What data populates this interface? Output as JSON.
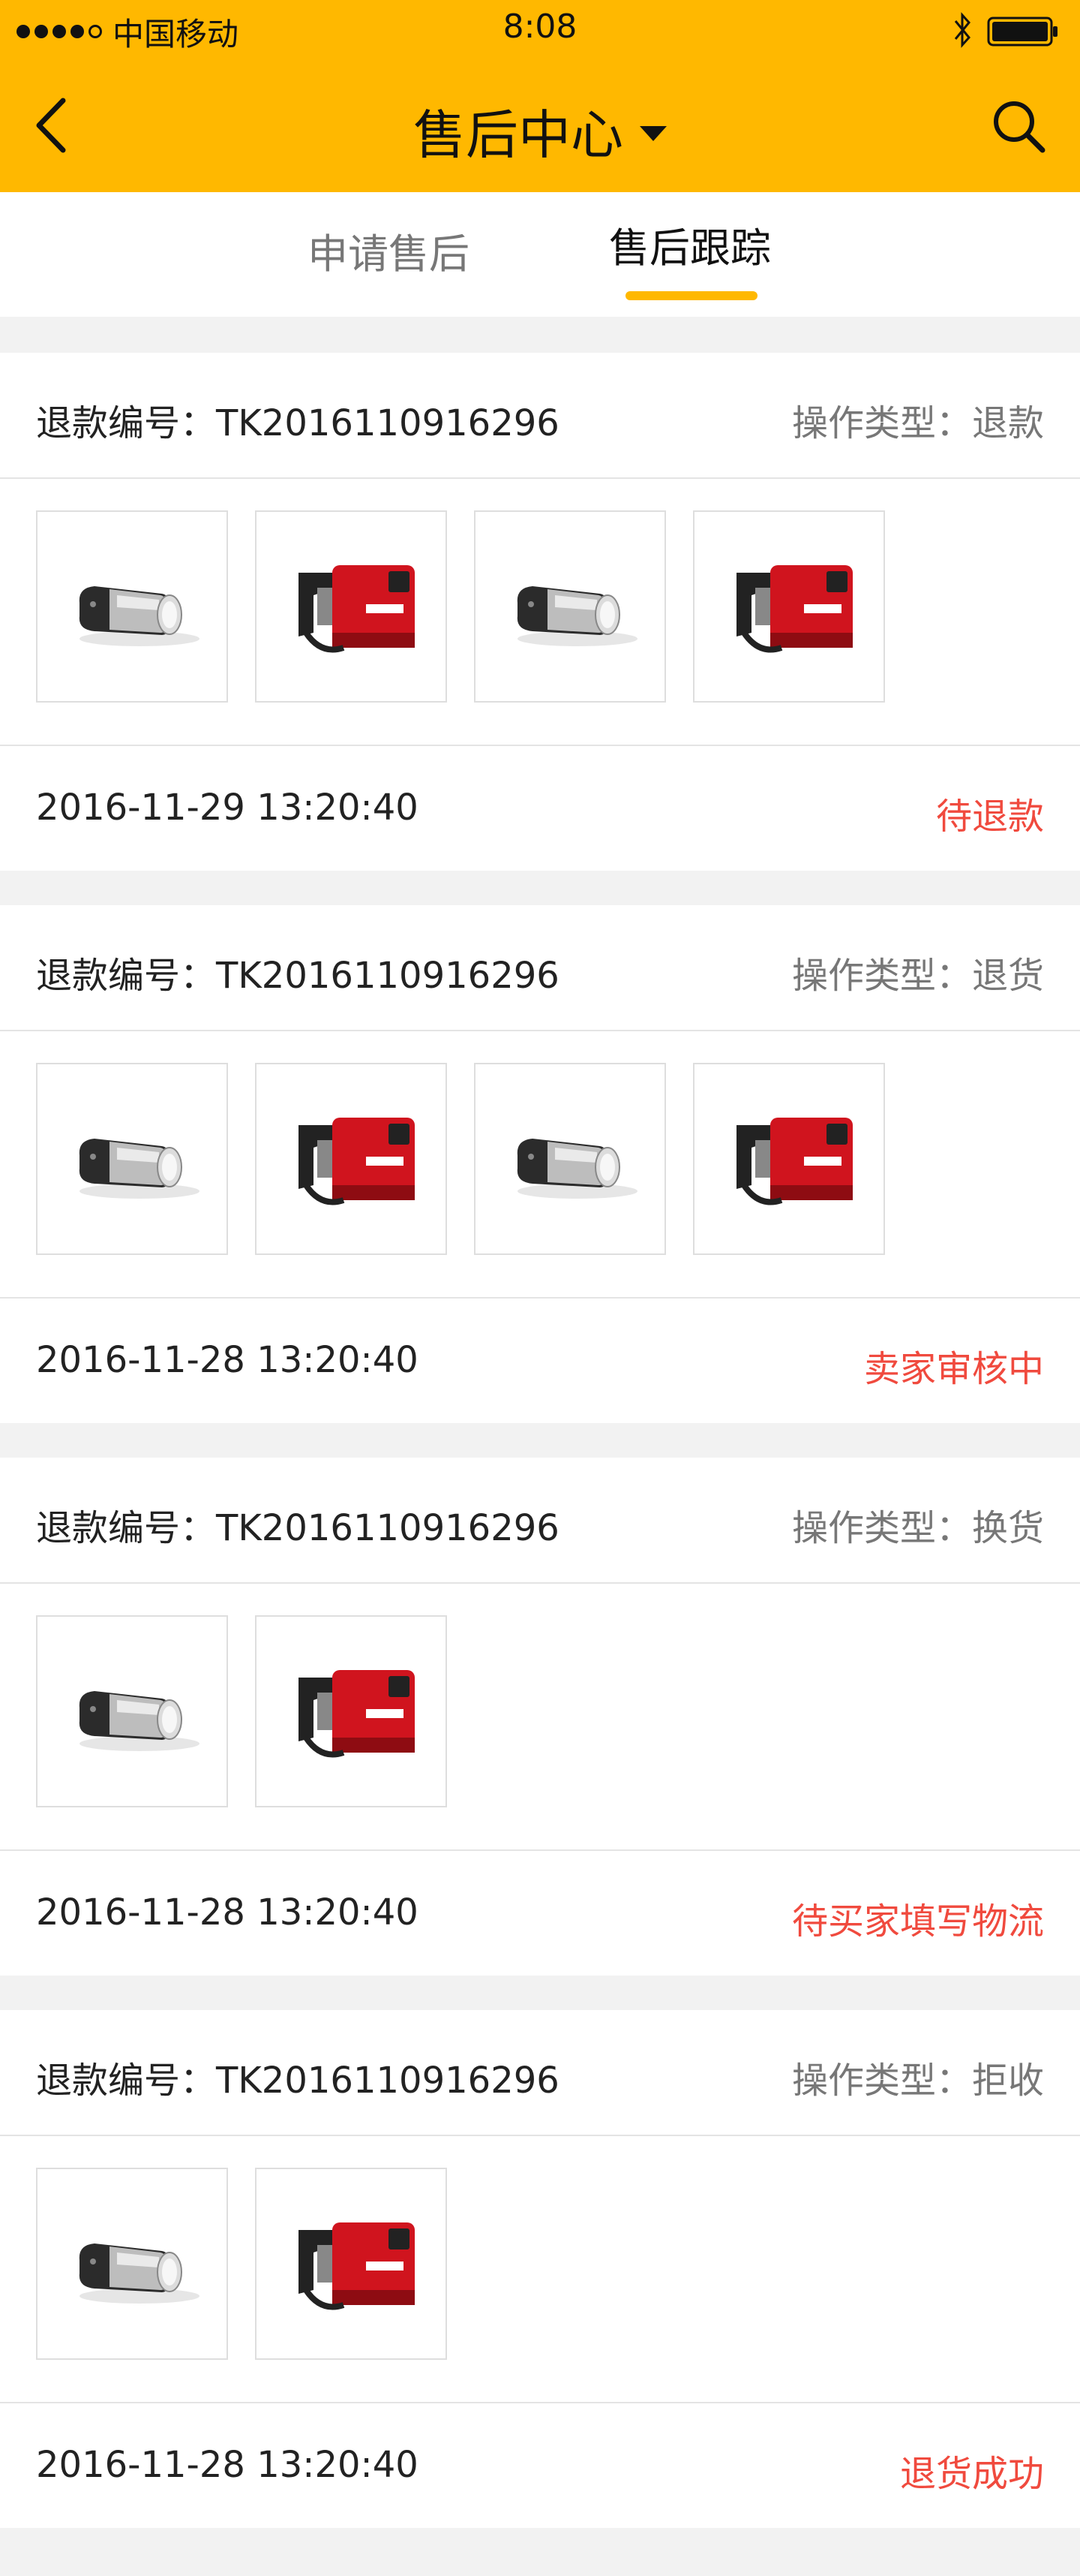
{
  "status_bar": {
    "carrier": "中国移动",
    "time": "8:08"
  },
  "header": {
    "title": "售后中心"
  },
  "tabs": [
    {
      "label": "申请售后",
      "active": false
    },
    {
      "label": "售后跟踪",
      "active": true
    }
  ],
  "colors": {
    "accent": "#ffb800",
    "status_red": "#f04a3e"
  },
  "orders": [
    {
      "refund_label": "退款编号：TK2016110916296",
      "op_type": "操作类型：退款",
      "date": "2016-11-29   13:20:40",
      "status": "待退款",
      "thumbnails": [
        "flashlight",
        "red-tool",
        "flashlight",
        "red-tool"
      ]
    },
    {
      "refund_label": "退款编号：TK2016110916296",
      "op_type": "操作类型：退货",
      "date": "2016-11-28   13:20:40",
      "status": "卖家审核中",
      "thumbnails": [
        "flashlight",
        "red-tool",
        "flashlight",
        "red-tool"
      ]
    },
    {
      "refund_label": "退款编号：TK2016110916296",
      "op_type": "操作类型：换货",
      "date": "2016-11-28   13:20:40",
      "status": "待买家填写物流",
      "thumbnails": [
        "flashlight",
        "red-tool"
      ]
    },
    {
      "refund_label": "退款编号：TK2016110916296",
      "op_type": "操作类型：拒收",
      "date": "2016-11-28   13:20:40",
      "status": "退货成功",
      "thumbnails": [
        "flashlight",
        "red-tool"
      ]
    }
  ]
}
